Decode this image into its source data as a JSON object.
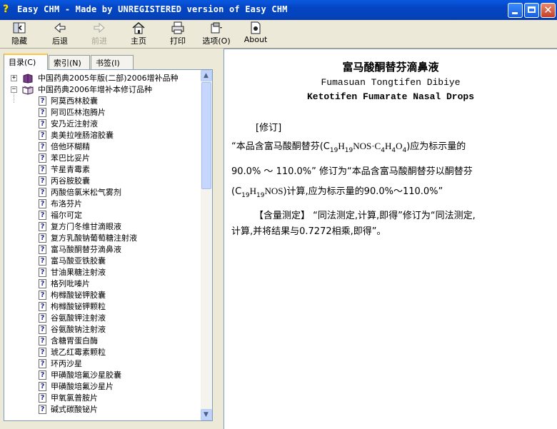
{
  "window": {
    "title": "Easy CHM - Made by UNREGISTERED version of Easy CHM"
  },
  "toolbar": {
    "hide": "隐藏",
    "back": "后退",
    "forward": "前进",
    "home": "主页",
    "print": "打印",
    "options": "选项(O)",
    "about": "About"
  },
  "tabs": {
    "contents": "目录(C)",
    "index": "索引(N)",
    "bookmarks": "书签(I)"
  },
  "tree": {
    "book1": "中国药典2005年版(二部)2006增补品种",
    "book2": "中国药典2006年增补本修订品种",
    "items": [
      "阿莫西林胶囊",
      "阿司匹林泡腾片",
      "安乃近注射液",
      "奥美拉唑肠溶胶囊",
      "倍他环糊精",
      "苯巴比妥片",
      "苄星青霉素",
      "丙谷胺胶囊",
      "丙酸倍氯米松气雾剂",
      "布洛芬片",
      "福尔可定",
      "复方门冬维甘滴眼液",
      "复方乳酸钠葡萄糖注射液",
      "富马酸酮替芬滴鼻液",
      "富马酸亚铁胶囊",
      "甘油果糖注射液",
      "格列吡嗪片",
      "枸橼酸铋钾胶囊",
      "枸橼酸铋钾颗粒",
      "谷氨酸钾注射液",
      "谷氨酸钠注射液",
      "含糖胃蛋白酶",
      "琥乙红霉素颗粒",
      "环丙沙星",
      "甲磺酸培氟沙星胶囊",
      "甲磺酸培氟沙星片",
      "甲氧氯普胺片",
      "碱式碳酸铋片"
    ]
  },
  "content": {
    "title": "富马酸酮替芬滴鼻液",
    "pinyin": "Fumasuan Tongtifen Dibiye",
    "english": "Ketotifen Fumarate Nasal Drops",
    "revision_label": "[修订]",
    "p1_line1_a": "“本品含富马酸酮替芬(C",
    "p1_line1_b": ")应为标示量的",
    "p1_line2": "90.0% ～ 110.0%” 修订为“本品含富马酸酮替芬以酮替芬",
    "p1_line3_a": "(C",
    "p1_line3_b": ")计算,应为标示量的90.0%～110.0%”",
    "formula1": {
      "c": "19",
      "h": "19",
      "rest": "NOS·C",
      "c2": "4",
      "h2": "4",
      "o": "4"
    },
    "formula2": {
      "c": "19",
      "h": "19",
      "rest": "NOS"
    },
    "p2_label": "【含量测定】",
    "p2_line1": "“同法测定,计算,即得”修订为“同法测定,",
    "p2_line2": "计算,并将结果与0.7272相乘,即得”。"
  }
}
